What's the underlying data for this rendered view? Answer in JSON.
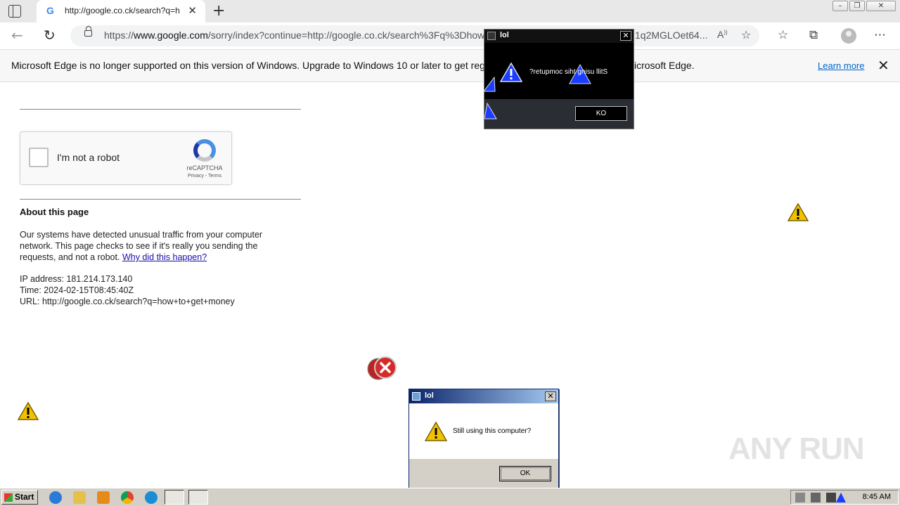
{
  "browser": {
    "tab_title": "http://google.co.ck/search?q=h",
    "tab_icon": "G",
    "url_prefix": "https://",
    "url_domain": "www.google.com",
    "url_rest": "/sorry/index?continue=http://google.co.ck/search%3Fq%3Dhow",
    "url_tail": "1q2MGLOet64...",
    "infobar_message": "Microsoft Edge is no longer supported on this version of Windows. Upgrade to Windows 10 or later to get regular",
    "infobar_tail": "icrosoft Edge.",
    "learn_more": "Learn more"
  },
  "captcha": {
    "label": "I'm not a robot",
    "brand": "reCAPTCHA",
    "terms": "Privacy - Terms"
  },
  "page": {
    "about_heading": "About this page",
    "paragraph": "Our systems have detected unusual traffic from your computer network. This page checks to see if it's really you sending the requests, and not a robot.",
    "why_link": "Why did this happen?",
    "ip_line": "IP address: 181.214.173.140",
    "time_line": "Time: 2024-02-15T08:45:40Z",
    "url_line": "URL: http://google.co.ck/search?q=how+to+get+money"
  },
  "dialog_reversed": {
    "title": "lol",
    "message": "?retupmoc siht gnisu llitS",
    "button": "KO"
  },
  "dialog_normal": {
    "title": "lol",
    "message": "Still using this computer?",
    "button": "OK"
  },
  "taskbar": {
    "start": "Start",
    "clock": "8:45 AM"
  },
  "watermark": "ANY RUN"
}
